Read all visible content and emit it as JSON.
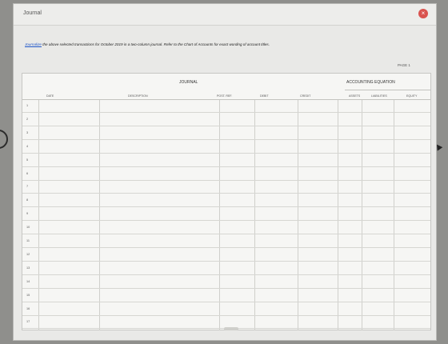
{
  "window": {
    "title": "Journal"
  },
  "instructions": {
    "link": "Journalize",
    "text": " the above selected transactions for October 2019 in a two-column journal. Refer to the Chart of Accounts for exact wording of account titles."
  },
  "page_label": "PAGE 1",
  "journal": {
    "title": "JOURNAL",
    "equation_title": "ACCOUNTING EQUATION",
    "columns": {
      "date": "DATE",
      "description": "DESCRIPTION",
      "post_ref": "POST. REF.",
      "debit": "DEBIT",
      "credit": "CREDIT",
      "assets": "ASSETS",
      "liabilities": "LIABILITIES",
      "equity": "EQUITY"
    },
    "row_numbers": [
      "1",
      "2",
      "3",
      "4",
      "5",
      "6",
      "7",
      "8",
      "9",
      "10",
      "11",
      "12",
      "13",
      "14",
      "15",
      "16",
      "17"
    ]
  }
}
